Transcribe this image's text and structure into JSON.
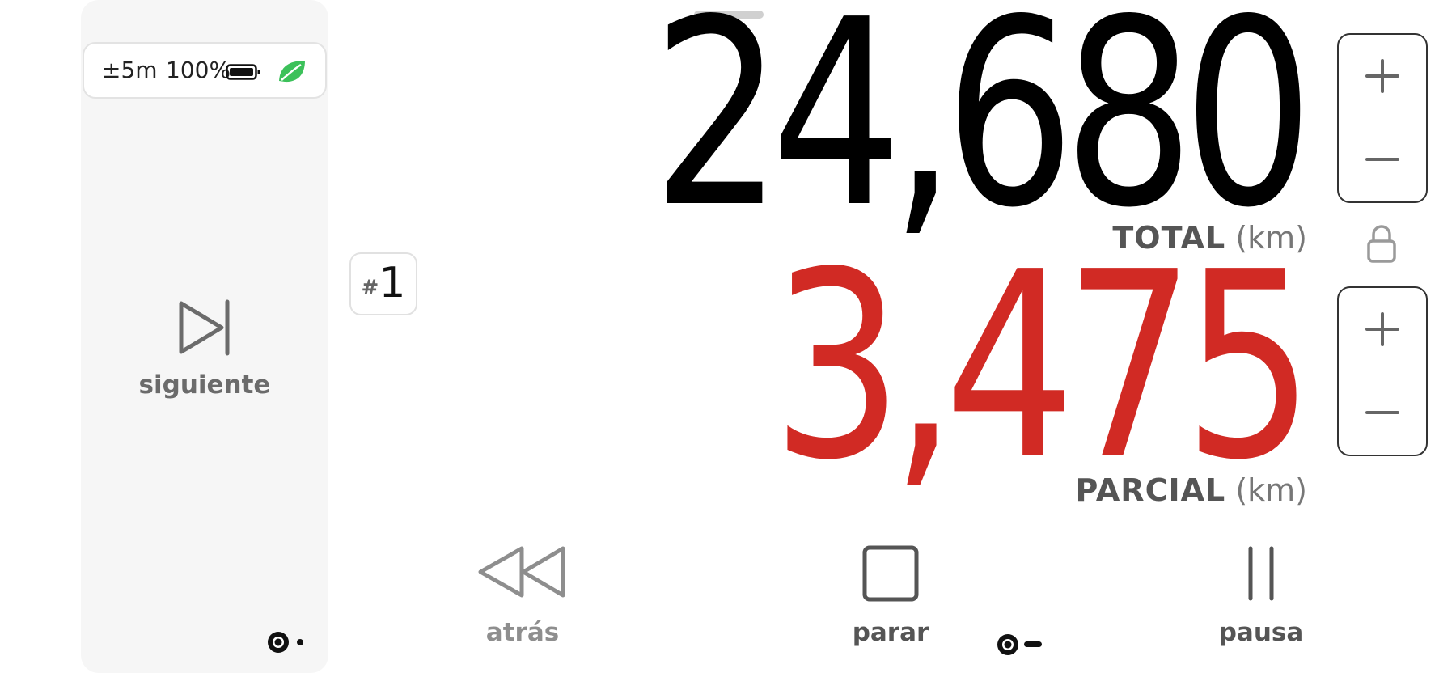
{
  "status": {
    "accuracy": "±5m",
    "battery": "100%",
    "battery_icon": "battery-full-icon",
    "eco_icon": "leaf-icon",
    "eco_color": "#3cc15a"
  },
  "next": {
    "icon": "skip-next-icon",
    "label": "siguiente"
  },
  "segment": {
    "hash": "#",
    "number": "1"
  },
  "odometer": {
    "total_value": "24,680",
    "total_label": "TOTAL",
    "total_unit": "(km)",
    "partial_value": "3,475",
    "partial_label": "PARCIAL",
    "partial_unit": "(km)",
    "partial_color": "#d12a24"
  },
  "steppers": {
    "increase_icon": "plus-icon",
    "decrease_icon": "minus-icon",
    "lock_icon": "lock-icon"
  },
  "controls": [
    {
      "label": "atrás",
      "icon": "rewind-icon",
      "color": "#8e8e8e"
    },
    {
      "label": "parar",
      "icon": "stop-icon",
      "color": "#555555"
    },
    {
      "label": "pausa",
      "icon": "pause-icon",
      "color": "#555555"
    }
  ]
}
